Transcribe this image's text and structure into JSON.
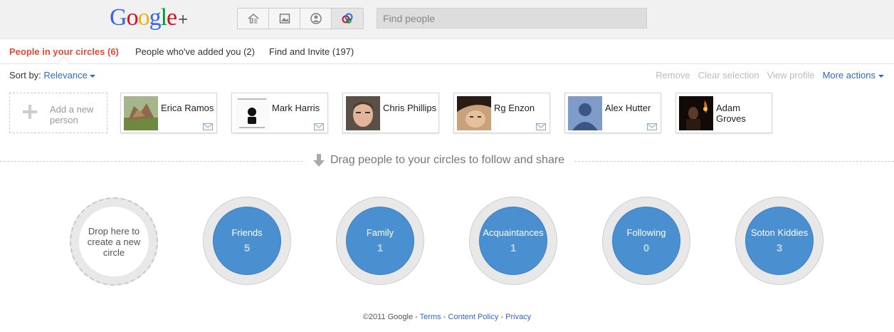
{
  "header": {
    "logo_text": "Google",
    "logo_plus": "+",
    "nav_icons": [
      "home-icon",
      "photos-icon",
      "profile-icon",
      "circles-icon"
    ],
    "search_placeholder": "Find people"
  },
  "tabs": [
    {
      "label": "People in your circles (6)",
      "active": true
    },
    {
      "label": "People who've added you (2)",
      "active": false
    },
    {
      "label": "Find and Invite (197)",
      "active": false
    }
  ],
  "sort": {
    "label": "Sort by:",
    "value": "Relevance"
  },
  "actions": {
    "remove": "Remove",
    "clear": "Clear selection",
    "view": "View profile",
    "more": "More actions"
  },
  "add_person": {
    "label": "Add a new person"
  },
  "people": [
    {
      "name": "Erica Ramos"
    },
    {
      "name": "Mark Harris"
    },
    {
      "name": "Chris Phillips"
    },
    {
      "name": "Rg Enzon"
    },
    {
      "name": "Alex Hutter"
    },
    {
      "name": "Adam Groves"
    }
  ],
  "drag_hint": "Drag people to your circles to follow and share",
  "drop_circle": {
    "label": "Drop here to create a new circle"
  },
  "circles": [
    {
      "name": "Friends",
      "count": "5"
    },
    {
      "name": "Family",
      "count": "1"
    },
    {
      "name": "Acquaintances",
      "count": "1"
    },
    {
      "name": "Following",
      "count": "0"
    },
    {
      "name": "Soton Kiddies",
      "count": "3"
    }
  ],
  "footer": {
    "copyright": "©2011 Google",
    "terms": "Terms",
    "policy": "Content Policy",
    "privacy": "Privacy"
  },
  "colors": {
    "accent": "#dd4b39",
    "link": "#3366cc",
    "circle_blue": "#4a90d0"
  }
}
